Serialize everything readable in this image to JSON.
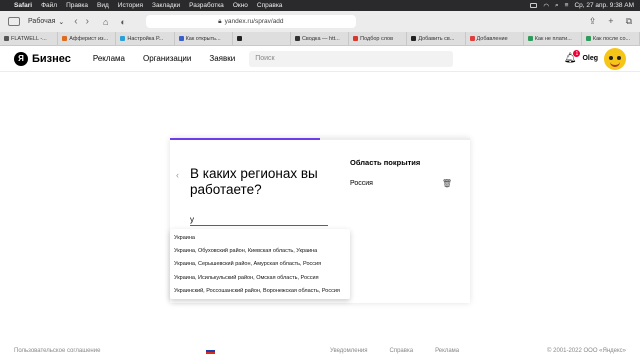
{
  "menubar": {
    "app": "Safari",
    "items": [
      "Файл",
      "Правка",
      "Вид",
      "История",
      "Закладки",
      "Разработка",
      "Окно",
      "Справка"
    ],
    "datetime": "Ср, 27 апр.  9:38 AM"
  },
  "toolbar": {
    "tab_group": "Рабочая",
    "url": "yandex.ru/sprav/add"
  },
  "tabs": [
    {
      "label": "FLATWELL -...",
      "color": "#555555"
    },
    {
      "label": "Афферист из...",
      "color": "#e06a1f"
    },
    {
      "label": "Настройка Р...",
      "color": "#2aa1d6"
    },
    {
      "label": "Как открыть...",
      "color": "#3a5fcc"
    },
    {
      "label": "",
      "color": "#222222"
    },
    {
      "label": "Сводка — htt...",
      "color": "#333333"
    },
    {
      "label": "Подбор слов",
      "color": "#d9372b"
    },
    {
      "label": "Добавить св...",
      "color": "#222222"
    },
    {
      "label": "Добавление",
      "color": "#e03d3d"
    },
    {
      "label": "Как не плати...",
      "color": "#2d9c5a"
    },
    {
      "label": "Как после со...",
      "color": "#2d9c5a"
    }
  ],
  "header": {
    "logo_mark": "Я",
    "logo_text": "Бизнес",
    "nav": [
      "Реклама",
      "Организации",
      "Заявки"
    ],
    "search_placeholder": "Поиск",
    "notifications_count": "1",
    "user": "Oleg"
  },
  "card": {
    "progress": 0.5,
    "title": "В каких регионах вы работаете?",
    "field_label": "",
    "field_value": "у",
    "coverage_title": "Область покрытия",
    "coverage_item": "Россия"
  },
  "suggestions": [
    "Украина",
    "Украина, Обуховский район, Киевская область, Украина",
    "Украина, Серышевский район, Амурская область, Россия",
    "Украина, Исилькульский район, Омская область, Россия",
    "Украинский, Россошанский район, Воронежская область, Россия"
  ],
  "footer": {
    "agreement": "Пользовательское соглашение",
    "links": [
      "Уведомления",
      "Справка",
      "Реклама"
    ],
    "copyright": "© 2001-2022 ООО «Яндекс»"
  }
}
